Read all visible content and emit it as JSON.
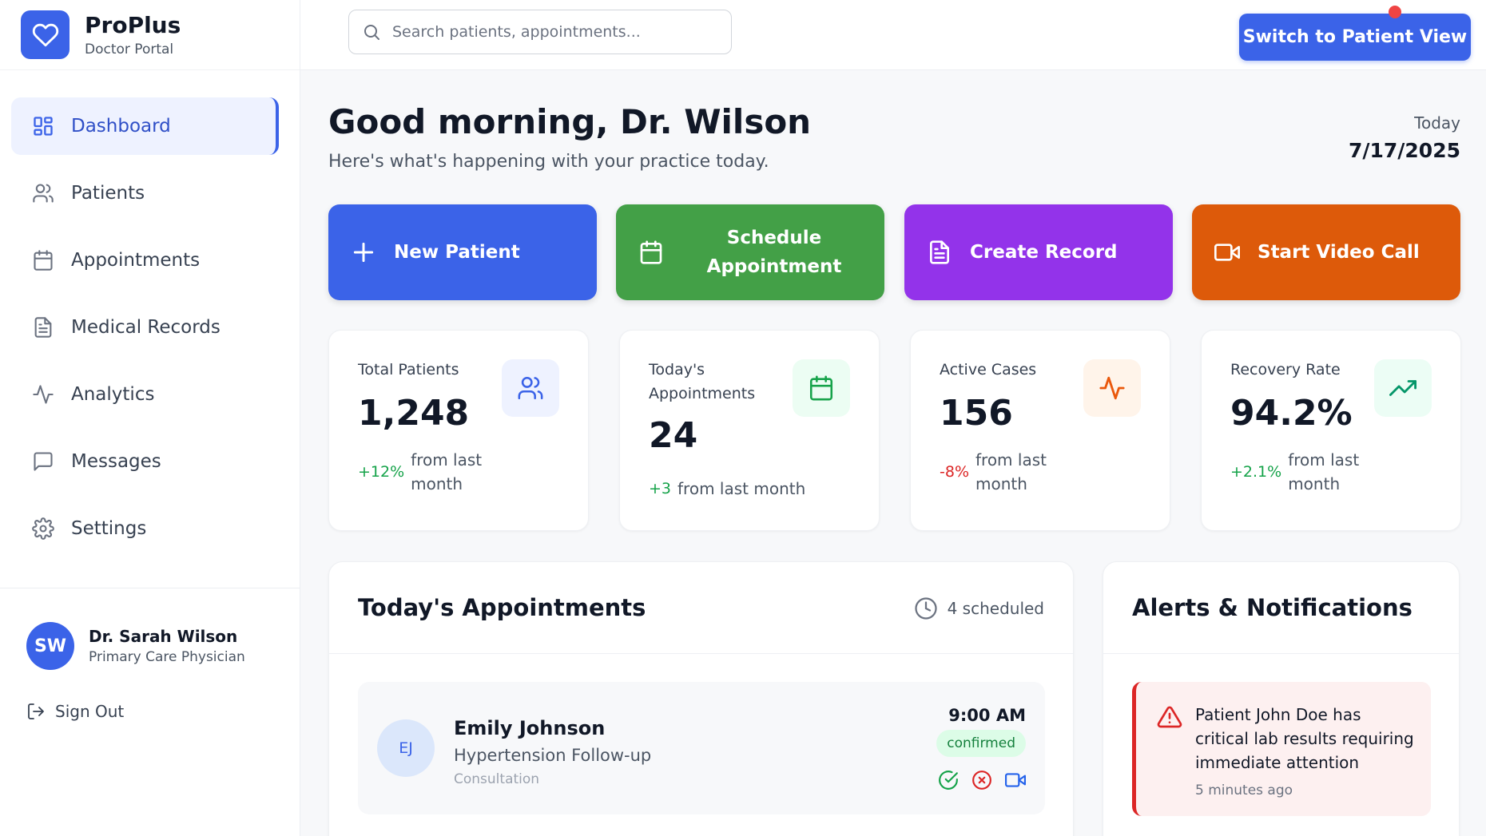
{
  "brand": {
    "name": "ProPlus",
    "subtitle": "Doctor Portal"
  },
  "sidebar": {
    "items": [
      {
        "label": "Dashboard",
        "icon": "grid-icon",
        "active": true
      },
      {
        "label": "Patients",
        "icon": "users-icon"
      },
      {
        "label": "Appointments",
        "icon": "calendar-icon"
      },
      {
        "label": "Medical Records",
        "icon": "file-icon"
      },
      {
        "label": "Analytics",
        "icon": "activity-icon"
      },
      {
        "label": "Messages",
        "icon": "message-icon"
      },
      {
        "label": "Settings",
        "icon": "gear-icon"
      }
    ],
    "user": {
      "initials": "SW",
      "name": "Dr. Sarah Wilson",
      "role": "Primary Care Physician"
    },
    "sign_out": "Sign Out"
  },
  "topbar": {
    "search_placeholder": "Search patients, appointments...",
    "switch_label": "Switch to Patient View"
  },
  "header": {
    "greeting": "Good morning, Dr. Wilson",
    "subtitle": "Here's what's happening with your practice today.",
    "today_label": "Today",
    "date": "7/17/2025"
  },
  "actions": [
    {
      "label": "New Patient",
      "color": "#3b63e8"
    },
    {
      "label": "Schedule Appointment",
      "color": "#43a047"
    },
    {
      "label": "Create Record",
      "color": "#9333ea"
    },
    {
      "label": "Start Video Call",
      "color": "#dd5a0a"
    }
  ],
  "stats": [
    {
      "label": "Total Patients",
      "value": "1,248",
      "change": "+12%",
      "change_text": "from last month",
      "trend": "up"
    },
    {
      "label": "Today's Appointments",
      "value": "24",
      "change": "+3",
      "change_text": "from last month",
      "trend": "up"
    },
    {
      "label": "Active Cases",
      "value": "156",
      "change": "-8%",
      "change_text": "from last month",
      "trend": "down"
    },
    {
      "label": "Recovery Rate",
      "value": "94.2%",
      "change": "+2.1%",
      "change_text": "from last month",
      "trend": "up"
    }
  ],
  "appointments_panel": {
    "title": "Today's Appointments",
    "scheduled": "4 scheduled",
    "items": [
      {
        "initials": "EJ",
        "name": "Emily Johnson",
        "reason": "Hypertension Follow-up",
        "type": "Consultation",
        "time": "9:00 AM",
        "status": "confirmed"
      }
    ]
  },
  "alerts_panel": {
    "title": "Alerts & Notifications",
    "items": [
      {
        "text": "Patient John Doe has critical lab results requiring immediate attention",
        "time": "5 minutes ago",
        "severity": "critical"
      }
    ]
  }
}
